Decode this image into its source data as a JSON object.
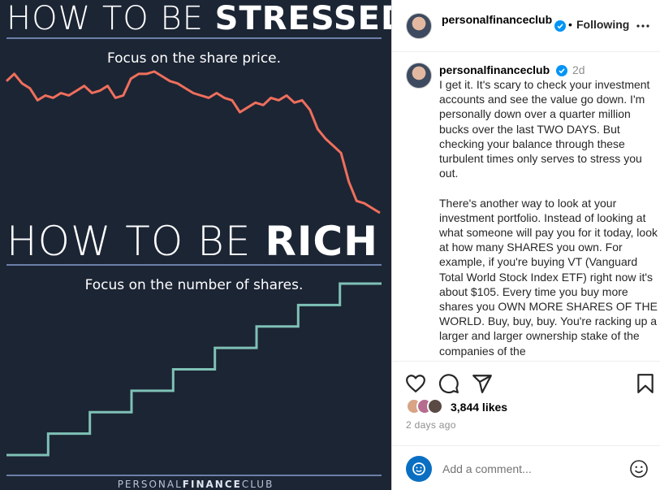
{
  "image": {
    "title_top_light": "HOW TO BE ",
    "title_top_bold": "STRESSED",
    "subtitle_top": "Focus on the share price.",
    "title_bottom_light": "HOW TO BE ",
    "title_bottom_bold": "RICH",
    "subtitle_bottom": "Focus on the number of shares.",
    "footer_light_1": "PERSONAL",
    "footer_bold": "FINANCE",
    "footer_light_2": "CLUB",
    "colors": {
      "background": "#1c2534",
      "price_line": "#ef6f5c",
      "shares_line": "#7fc1b6",
      "rule": "#6c7fa8"
    }
  },
  "chart_data": [
    {
      "type": "line",
      "series": [
        {
          "values": [
            100,
            103,
            99,
            97,
            92,
            94,
            93,
            95,
            94,
            96,
            98,
            95,
            96,
            98,
            93,
            94,
            101,
            103,
            103,
            104,
            102,
            100,
            99,
            97,
            95,
            94,
            93,
            95,
            93,
            92,
            87,
            89,
            91,
            90,
            93,
            92,
            94,
            91,
            92,
            88,
            80,
            76,
            73,
            70,
            58,
            50,
            49,
            47,
            45
          ]
        }
      ]
    },
    {
      "type": "line",
      "series": [
        {
          "values": [
            1,
            2,
            3,
            4,
            5,
            6,
            7,
            8,
            9
          ]
        }
      ]
    }
  ],
  "header": {
    "username": "personalfinanceclub",
    "separator": "•",
    "follow_label": "Following",
    "more_icon": "more-horizontal-icon"
  },
  "caption": {
    "username": "personalfinanceclub",
    "time": "2d",
    "text": "I get it. It's scary to check your investment accounts and see the value go down. I'm personally down over a quarter million bucks over the last TWO DAYS. But checking your balance through these turbulent times only serves to stress you out.\n\nThere's another way to look at your investment portfolio. Instead of looking at what someone will pay you for it today, look at how many SHARES you own. For example, if you're buying VT (Vanguard Total World Stock Index ETF) right now it's about $105. Every time you buy more shares you OWN MORE SHARES OF THE WORLD. Buy, buy, buy. You're racking up a larger and larger ownership stake of the companies of the"
  },
  "actions": {
    "like_icon": "heart-icon",
    "comment_icon": "comment-icon",
    "share_icon": "send-icon",
    "save_icon": "bookmark-icon"
  },
  "likes": {
    "count_label": "3,844 likes"
  },
  "post_time": "2 days ago",
  "comment": {
    "placeholder": "Add a comment...",
    "emoji_icon": "smile-icon"
  },
  "accent_color": "#0095f6"
}
